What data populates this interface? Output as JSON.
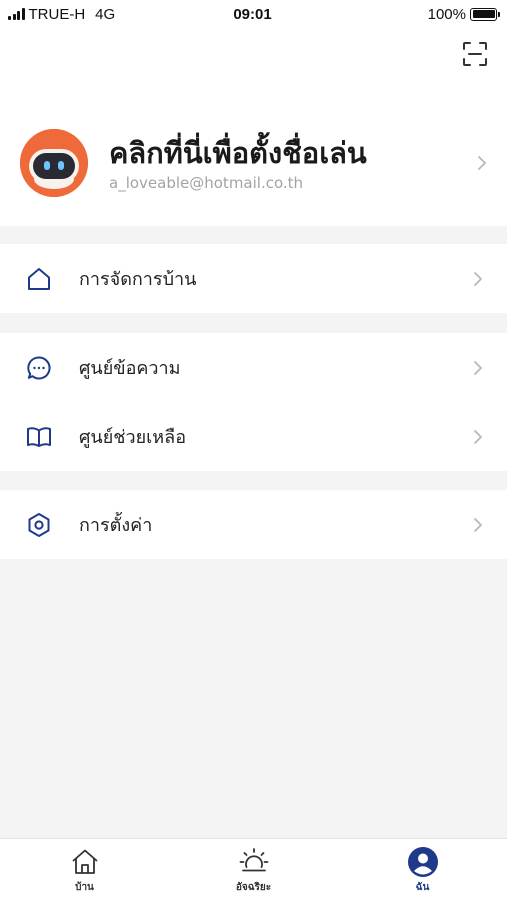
{
  "status_bar": {
    "carrier": "TRUE-H",
    "network": "4G",
    "time": "09:01",
    "battery_percent": "100%",
    "battery_level": 1.0
  },
  "profile": {
    "nickname": "คลิกที่นี่เพื่อตั้งชื่อเล่น",
    "email": "a_loveable@hotmail.co.th"
  },
  "menu": {
    "home_management": "การจัดการบ้าน",
    "message_center": "ศูนย์ข้อความ",
    "help_center": "ศูนย์ช่วยเหลือ",
    "settings": "การตั้งค่า"
  },
  "tabbar": {
    "tabs": [
      {
        "label": "บ้าน",
        "icon": "home-icon"
      },
      {
        "label": "อัจฉริยะ",
        "icon": "sun-icon"
      },
      {
        "label": "ฉัน",
        "icon": "user-icon"
      }
    ],
    "active": "ฉัน"
  },
  "colors": {
    "accent": "#1f3a8a",
    "avatar_orange": "#ef6a3a",
    "background": "#f4f4f4"
  }
}
